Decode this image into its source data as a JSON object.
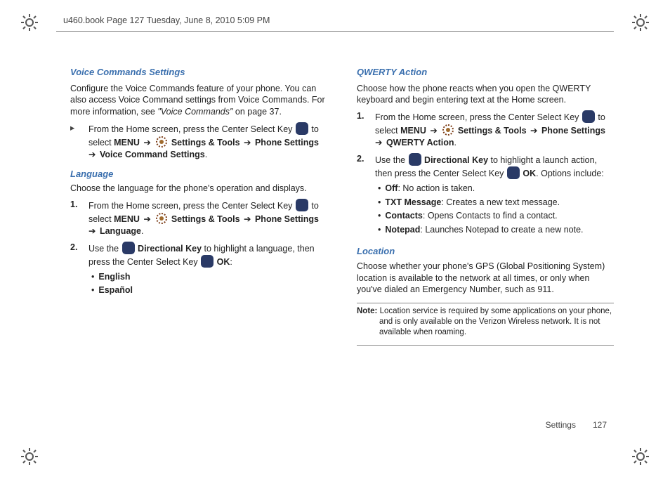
{
  "header": {
    "text": "u460.book  Page 127  Tuesday, June 8, 2010  5:09 PM"
  },
  "left": {
    "voice_title": "Voice Commands Settings",
    "voice_para": "Configure the Voice Commands feature of your phone. You can also access Voice Command settings from Voice Commands. For more information, see ",
    "voice_ref": "\"Voice Commands\"",
    "voice_ref_tail": " on page 37.",
    "voice_step_lead": "From the Home screen, press the Center Select Key ",
    "to_select": " to select ",
    "menu": "MENU",
    "arrow": " ➔ ",
    "settings_tools": " Settings & Tools",
    "phone_settings": "Phone Settings",
    "voice_cmd_settings": "Voice Command Settings",
    "lang_title": "Language",
    "lang_para": "Choose the language for the phone's operation and displays.",
    "step1_lead": "From the Home screen, press the Center Select Key ",
    "lang_item": "Language",
    "step2_a": "Use the ",
    "dir_key": "Directional Key",
    "step2_b": " to highlight a language, then press the Center Select Key ",
    "ok": "OK",
    "english": "English",
    "espanol": "Español"
  },
  "right": {
    "qwerty_title": "QWERTY Action",
    "qwerty_para": "Choose how the phone reacts when you open the QWERTY keyboard and begin entering text at the Home screen.",
    "step1_lead": "From the Home screen, press the Center Select Key ",
    "to_select": " to select ",
    "menu": "MENU",
    "arrow": " ➔ ",
    "settings_tools": " Settings & Tools",
    "phone_settings": "Phone Settings",
    "qwerty_action": "QWERTY Action",
    "step2_a": "Use the ",
    "dir_key": "Directional Key",
    "step2_b": " to highlight a launch action, then press the Center Select Key ",
    "ok": "OK",
    "step2_c": ". Options include:",
    "off_label": "Off",
    "off_desc": ": No action is taken.",
    "txt_label": "TXT Message",
    "txt_desc": ": Creates a new text message.",
    "contacts_label": "Contacts",
    "contacts_desc": ": Opens Contacts to find a contact.",
    "notepad_label": "Notepad",
    "notepad_desc": ": Launches Notepad to create a new note.",
    "loc_title": "Location",
    "loc_para": "Choose whether your phone's GPS (Global Positioning System) location is available to the network at all times, or only when you've dialed an Emergency Number, such as 911.",
    "note_label": "Note:",
    "note_text": " Location service is required by some applications on your phone, and is only available on the Verizon Wireless network. It is not available when roaming."
  },
  "footer": {
    "section": "Settings",
    "page": "127"
  }
}
